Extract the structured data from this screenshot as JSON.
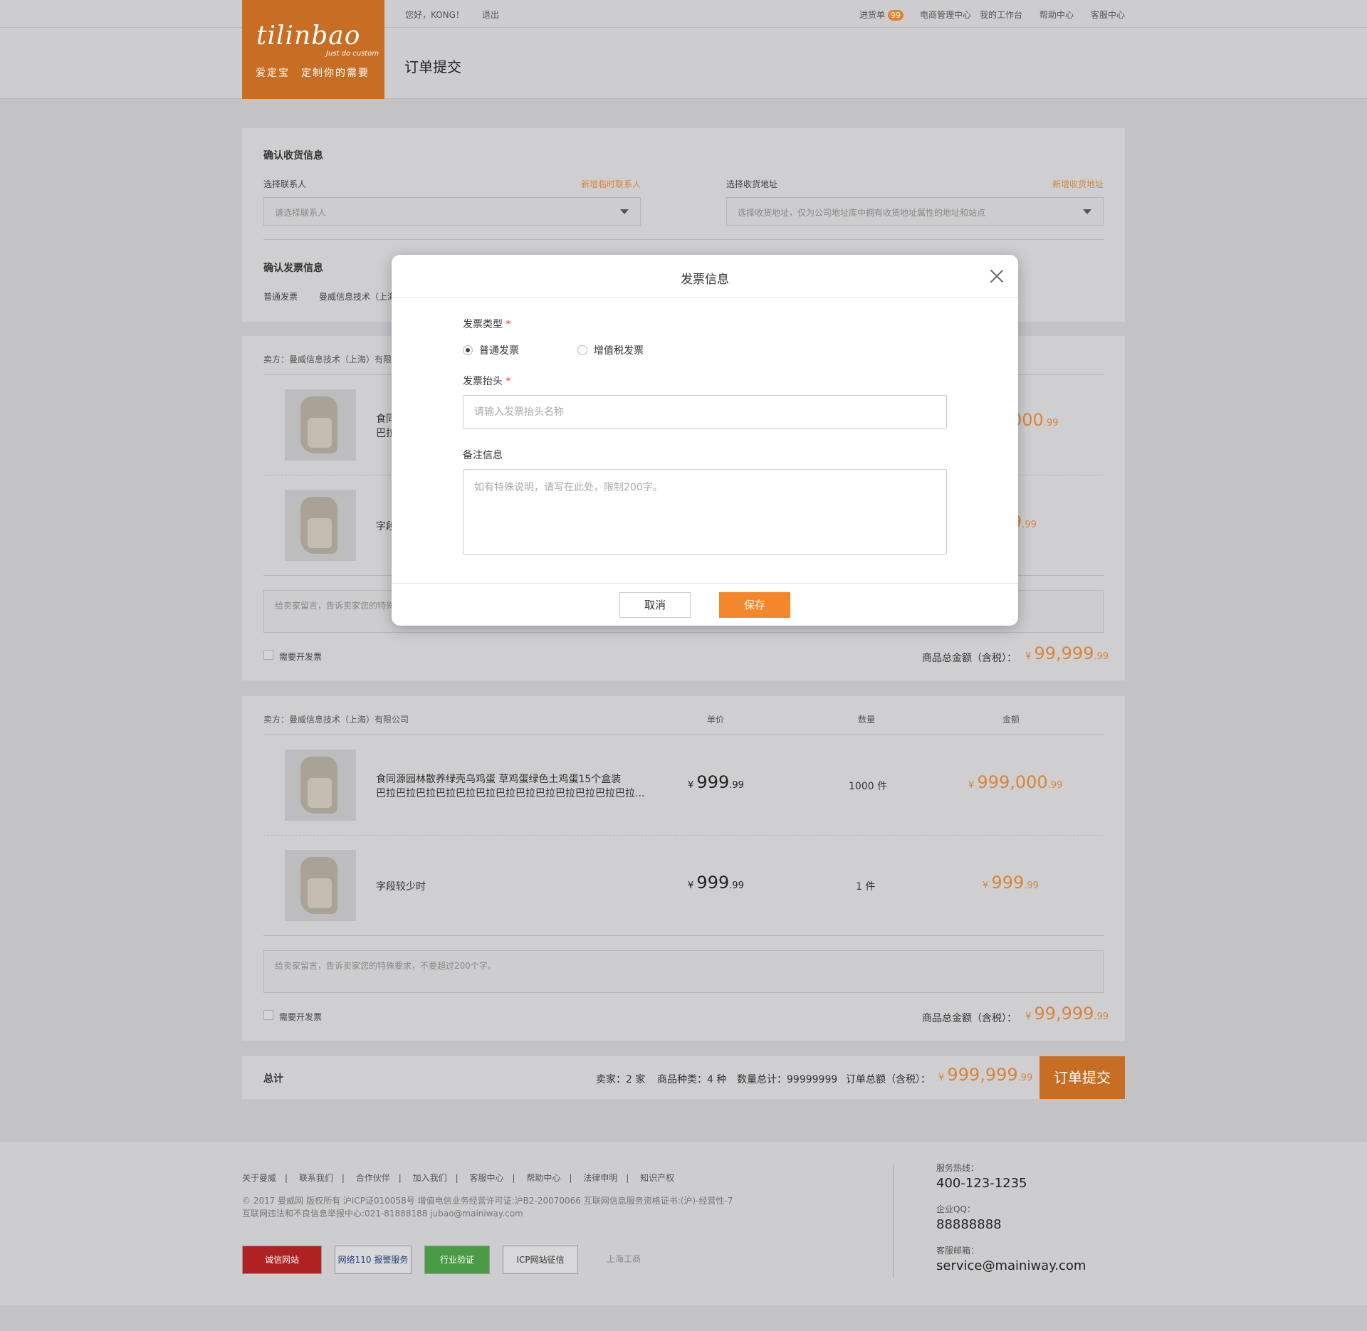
{
  "header": {
    "brand": "tilinbao",
    "brand_sub": "Just do custom",
    "slogan": "爱定宝　定制你的需要",
    "greeting": "您好，KONG！",
    "logout": "退出",
    "links": {
      "orders": "进货单",
      "orders_count": "99",
      "ecommerce": "电商管理中心",
      "workbench": "我的工作台",
      "help": "帮助中心",
      "service": "客服中心"
    },
    "page_title": "订单提交"
  },
  "shipping": {
    "title": "确认收货信息",
    "contact_label": "选择联系人",
    "contact_add": "新增临时联系人",
    "contact_placeholder": "请选择联系人",
    "address_label": "选择收货地址",
    "address_add": "新增收货地址",
    "address_placeholder": "选择收货地址，仅为公司地址库中拥有收货地址属性的地址和站点"
  },
  "invoice": {
    "title": "确认发票信息",
    "type": "普通发票",
    "company": "曼威信息技术（上海"
  },
  "seller1": {
    "seller": "卖方：曼威信息技术（上海）有限",
    "item1": {
      "name": "食同",
      "name2": "巴拉",
      "amount_int": "000",
      "amount_dec": ".99"
    },
    "item2": {
      "name": "字段",
      "amount_int": "9",
      "amount_dec": ".99"
    },
    "note_placeholder": "给卖家留言，告诉卖家您的特殊",
    "need_invoice": "需要开发票",
    "total_label": "商品总金额（含税）：",
    "total_currency": "¥",
    "total_int": "99,999",
    "total_dec": ".99"
  },
  "seller2": {
    "seller": "卖方：曼威信息技术（上海）有限公司",
    "col_price": "单价",
    "col_qty": "数量",
    "col_amount": "金额",
    "items": [
      {
        "name": "食同源园林散养绿壳乌鸡蛋 草鸡蛋绿色土鸡蛋15个盒装",
        "name2": "巴拉巴拉巴拉巴拉巴拉巴拉巴拉巴拉巴拉巴拉巴拉巴拉巴拉...",
        "price_int": "999",
        "price_dec": ".99",
        "qty": "1000 件",
        "amount_int": "999,000",
        "amount_dec": ".99"
      },
      {
        "name": "字段较少时",
        "name2": "",
        "price_int": "999",
        "price_dec": ".99",
        "qty": "1 件",
        "amount_int": "999",
        "amount_dec": ".99"
      }
    ],
    "currency": "¥",
    "note_placeholder": "给卖家留言，告诉卖家您的特殊要求，不要超过200个字。",
    "need_invoice": "需要开发票",
    "total_label": "商品总金额（含税）：",
    "total_int": "99,999",
    "total_dec": ".99"
  },
  "summary": {
    "label": "总计",
    "sellers": "卖家：2 家",
    "kinds": "商品种类：4 种",
    "qty": "数量总计：99999999",
    "total_label": "订单总额（含税）：",
    "currency": "¥",
    "total_int": "999,999",
    "total_dec": ".99",
    "submit": "订单提交"
  },
  "footer": {
    "links": [
      "关于曼威",
      "联系我们",
      "合作伙伴",
      "加入我们",
      "客服中心",
      "帮助中心",
      "法律申明",
      "知识产权"
    ],
    "copyright": "© 2017 曼威网 版权所有  沪ICP证010058号   增值电信业务经营许可证:沪B2-20070066      互联网信息服务资格证书:(沪)-经营性-7",
    "report": "互联网违法和不良信息举报中心:021-81888188 jubao@mainiway.com",
    "badges": [
      "诚信网站",
      "网络110 报警服务",
      "行业验证",
      "ICP网站征信",
      "上海工商"
    ],
    "hotline_label": "服务热线：",
    "hotline": "400-123-1235",
    "qq_label": "企业QQ：",
    "qq": "88888888",
    "email_label": "客服邮箱：",
    "email": "service@mainiway.com"
  },
  "modal": {
    "title": "发票信息",
    "type_label": "发票类型",
    "required_mark": "*",
    "type_normal": "普通发票",
    "type_vat": "增值税发票",
    "header_label": "发票抬头",
    "header_placeholder": "请输入发票抬头名称",
    "remark_label": "备注信息",
    "remark_placeholder": "如有特殊说明，请写在此处，限制200字。",
    "cancel": "取消",
    "save": "保存"
  },
  "colors": {
    "brand": "#c86d24",
    "accent": "#f5872a",
    "price": "#d9843a",
    "overlay": "#c3c3c6"
  }
}
